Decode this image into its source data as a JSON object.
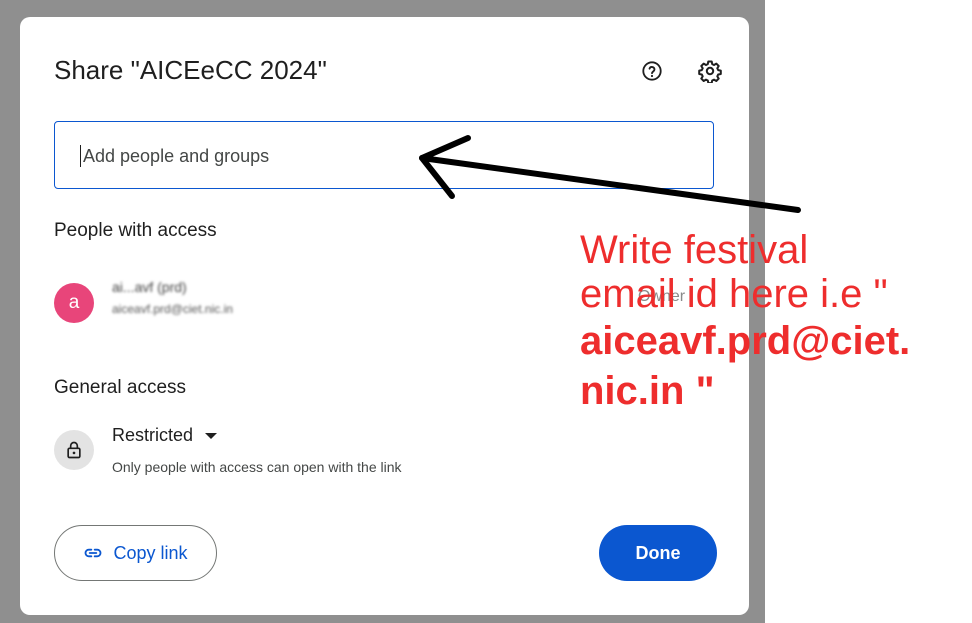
{
  "dialog": {
    "title": "Share \"AICEeCC 2024\"",
    "add_people_placeholder": "Add people and groups",
    "people_with_access_heading": "People with access",
    "person": {
      "avatar_letter": "a",
      "name": "ai...avf (prd)",
      "email": "aiceavf.prd@ciet.nic.in",
      "role": "Owner"
    },
    "general_access_heading": "General access",
    "access_level": "Restricted",
    "access_description": "Only people with access can open with the link",
    "copy_link_label": "Copy link",
    "done_label": "Done"
  },
  "annotation": {
    "line1": "Write festival",
    "line2": "email id here i.e \"",
    "line3": "aiceavf.prd@ciet.",
    "line4": "nic.in \""
  },
  "colors": {
    "accent": "#0b57d0",
    "avatar": "#e8457a",
    "annotation": "#ee2d2d",
    "backdrop": "#8f8f8f"
  },
  "icons": {
    "help": "help-circle-icon",
    "settings": "gear-icon",
    "lock": "lock-icon",
    "link": "link-icon",
    "dropdown": "caret-down-icon"
  }
}
